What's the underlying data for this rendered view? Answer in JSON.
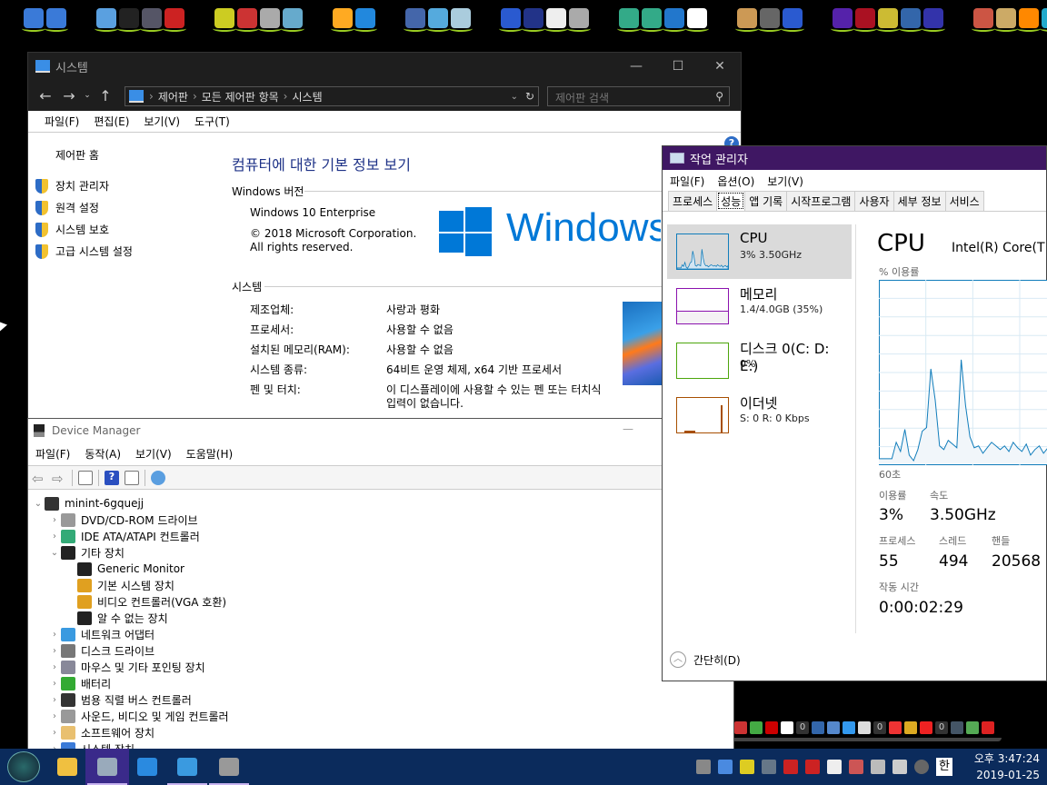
{
  "top_launcher": {
    "icons": [
      "network-settings-icon",
      "network-disabled-icon",
      "computer-icon",
      "monitor-icon",
      "display-settings-icon",
      "recycle-bin-icon",
      "puzzle-yellow-icon",
      "puzzle-red-icon",
      "disk-tool-icon",
      "book-icon",
      "flower-icon",
      "windows-icon",
      "pie-chart-icon",
      "wrench-tool-icon",
      "device-icon",
      "letter-a-icon",
      "fc-icon",
      "notepad-icon",
      "user-settings-icon",
      "drive-green-icon",
      "drive-refresh-icon",
      "bluetooth-icon",
      "7zip-icon",
      "cd-icon",
      "usb-icon",
      "64bit-icon",
      "chip-icon",
      "flash-icon",
      "lightbulb-icon",
      "network-drive-icon",
      "help-icon",
      "cubes-icon",
      "lock-icon",
      "search-orange-icon",
      "search-blue-icon",
      "save-icon",
      "folder-dark-icon",
      "power-icon"
    ]
  },
  "control_panel": {
    "title": "시스템",
    "breadcrumb": [
      "제어판",
      "모든 제어판 항목",
      "시스템"
    ],
    "search_placeholder": "제어판 검색",
    "menu": [
      "파일(F)",
      "편집(E)",
      "보기(V)",
      "도구(T)"
    ],
    "sidebar_home": "제어판 홈",
    "sidebar_links": [
      "장치 관리자",
      "원격 설정",
      "시스템 보호",
      "고급 시스템 설정"
    ],
    "heading": "컴퓨터에 대한 기본 정보 보기",
    "windows_section": "Windows 버전",
    "edition": "Windows 10 Enterprise",
    "copyright": "© 2018 Microsoft Corporation.",
    "rights": "All rights reserved.",
    "logo_text": "Windows",
    "system_section": "시스템",
    "system_rows": [
      {
        "label": "제조업체:",
        "value": "사랑과 평화"
      },
      {
        "label": "프로세서:",
        "value": "사용할 수 없음"
      },
      {
        "label": "설치된 메모리(RAM):",
        "value": "사용할 수 없음"
      },
      {
        "label": "시스템 종류:",
        "value": "64비트 운영 체제, x64 기반 프로세서"
      },
      {
        "label": "펜 및 터치:",
        "value": "이 디스플레이에 사용할 수 있는 펜 또는 터치식",
        "value2": "입력이 없습니다."
      }
    ],
    "help_label": "?"
  },
  "device_manager": {
    "title": "Device Manager",
    "menu": [
      "파일(F)",
      "동작(A)",
      "보기(V)",
      "도움말(H)"
    ],
    "minimize": "—",
    "tree": [
      {
        "label": "minint-6gquejj",
        "level": 0,
        "expanded": true,
        "icon": "computer-icon"
      },
      {
        "label": "DVD/CD-ROM 드라이브",
        "level": 1,
        "expanded": false,
        "icon": "dvd-drive-icon"
      },
      {
        "label": "IDE ATA/ATAPI 컨트롤러",
        "level": 1,
        "expanded": false,
        "icon": "ide-controller-icon"
      },
      {
        "label": "기타 장치",
        "level": 1,
        "expanded": true,
        "icon": "unknown-device-icon"
      },
      {
        "label": "Generic Monitor",
        "level": 2,
        "icon": "unknown-device-icon"
      },
      {
        "label": "기본 시스템 장치",
        "level": 2,
        "icon": "warning-device-icon"
      },
      {
        "label": "비디오 컨트롤러(VGA 호환)",
        "level": 2,
        "icon": "warning-device-icon"
      },
      {
        "label": "알 수 없는 장치",
        "level": 2,
        "icon": "unknown-device-icon"
      },
      {
        "label": "네트워크 어댑터",
        "level": 1,
        "expanded": false,
        "icon": "network-adapter-icon"
      },
      {
        "label": "디스크 드라이브",
        "level": 1,
        "expanded": false,
        "icon": "disk-drive-icon"
      },
      {
        "label": "마우스 및 기타 포인팅 장치",
        "level": 1,
        "expanded": false,
        "icon": "mouse-icon"
      },
      {
        "label": "배터리",
        "level": 1,
        "expanded": false,
        "icon": "battery-icon"
      },
      {
        "label": "범용 직렬 버스 컨트롤러",
        "level": 1,
        "expanded": false,
        "icon": "usb-icon"
      },
      {
        "label": "사운드, 비디오 및 게임 컨트롤러",
        "level": 1,
        "expanded": false,
        "icon": "speaker-icon"
      },
      {
        "label": "소프트웨어 장치",
        "level": 1,
        "expanded": false,
        "icon": "software-device-icon"
      },
      {
        "label": "시스템 장치",
        "level": 1,
        "expanded": false,
        "icon": "system-device-icon"
      }
    ]
  },
  "task_manager": {
    "title": "작업 관리자",
    "menu": [
      "파일(F)",
      "옵션(O)",
      "보기(V)"
    ],
    "tabs": [
      "프로세스",
      "성능",
      "앱 기록",
      "시작프로그램",
      "사용자",
      "세부 정보",
      "서비스"
    ],
    "active_tab": "성능",
    "perf_items": [
      {
        "name": "CPU",
        "value": "3% 3.50GHz",
        "color": "#117dbb"
      },
      {
        "name": "메모리",
        "value": "1.4/4.0GB (35%)",
        "color": "#8b12ae"
      },
      {
        "name": "디스크 0(C: D: E:)",
        "value": "0%",
        "color": "#4da60c"
      },
      {
        "name": "이더넷",
        "value": "S: 0 R: 0 Kbps",
        "color": "#a74f01"
      }
    ],
    "memory_fraction": 0.35,
    "detail_title": "CPU",
    "cpu_model": "Intel(R) Core(T",
    "graph_label": "% 이용률",
    "graph_time": "60초",
    "stats": {
      "usage_label": "이용률",
      "usage": "3%",
      "speed_label": "속도",
      "speed": "3.50GHz",
      "process_label": "프로세스",
      "processes": "55",
      "thread_label": "스레드",
      "threads": "494",
      "handle_label": "핸들",
      "handles": "20568",
      "uptime_label": "작동 시간",
      "uptime": "0:00:02:29"
    },
    "fewer_details": "간단히(D)"
  },
  "chart_data": {
    "type": "area",
    "title": "CPU",
    "ylabel": "% 이용률",
    "xlabel": "60초",
    "ylim": [
      0,
      100
    ],
    "values": [
      3,
      3,
      3,
      3,
      12,
      7,
      19,
      5,
      2,
      8,
      18,
      20,
      52,
      35,
      10,
      8,
      13,
      11,
      9,
      57,
      32,
      15,
      9,
      10,
      6,
      9,
      12,
      10,
      8,
      10,
      7,
      12,
      9,
      7,
      11,
      5,
      8,
      10,
      6,
      9
    ]
  },
  "dock": {
    "icons": [
      "calendar-icon",
      "soccer-icon",
      "hanja-icon",
      "go-icon",
      "counter-0",
      "network-icon",
      "search-computer-icon",
      "volume-icon",
      "laptop-icon",
      "counter-0",
      "v3-icon",
      "windows-color-icon",
      "kaspersky-icon",
      "counter-0",
      "monitor-pulse-icon",
      "ram-icon",
      "power-icon"
    ]
  },
  "taskbar": {
    "start_icon": "start-orb-icon",
    "apps": [
      {
        "name": "file-explorer-icon",
        "active": false,
        "open": false
      },
      {
        "name": "task-manager-icon",
        "active": true,
        "open": true
      },
      {
        "name": "internet-explorer-icon",
        "active": false,
        "open": false
      },
      {
        "name": "control-panel-icon",
        "active": false,
        "open": true
      },
      {
        "name": "device-manager-icon",
        "active": false,
        "open": true
      }
    ],
    "tray": [
      "grid-icon",
      "network-icon",
      "ie-toy-icon",
      "osd-icon",
      "magnet-icon",
      "red-bird-icon",
      "font-icon",
      "stamp-icon",
      "usb-eject-icon",
      "volume-icon",
      "close-circle-icon"
    ],
    "ime": "한",
    "time": "오후 3:47:24",
    "date": "2019-01-25"
  }
}
